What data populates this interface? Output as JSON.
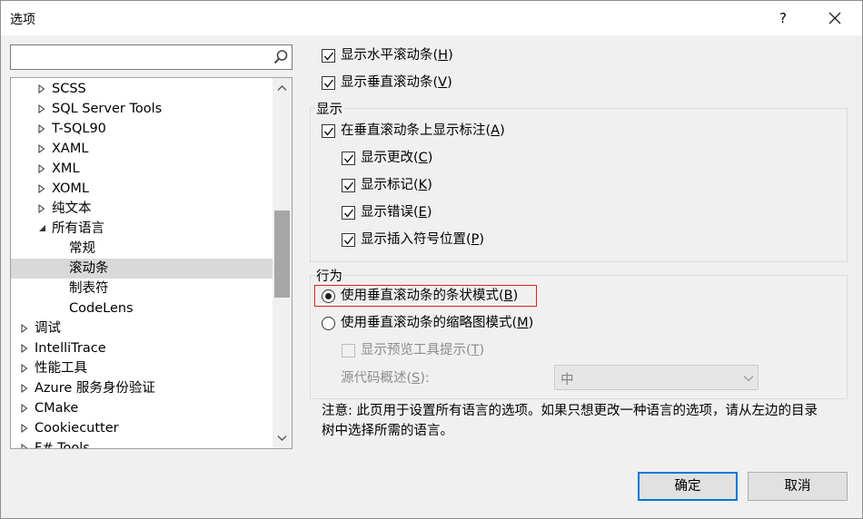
{
  "window": {
    "title": "选项",
    "help_label": "?"
  },
  "search": {
    "value": "",
    "placeholder": ""
  },
  "tree": {
    "items": [
      {
        "label": "SCSS",
        "level": 1,
        "arrow": "collapsed",
        "selected": false
      },
      {
        "label": "SQL Server Tools",
        "level": 1,
        "arrow": "collapsed",
        "selected": false
      },
      {
        "label": "T-SQL90",
        "level": 1,
        "arrow": "collapsed",
        "selected": false
      },
      {
        "label": "XAML",
        "level": 1,
        "arrow": "collapsed",
        "selected": false
      },
      {
        "label": "XML",
        "level": 1,
        "arrow": "collapsed",
        "selected": false
      },
      {
        "label": "XOML",
        "level": 1,
        "arrow": "collapsed",
        "selected": false
      },
      {
        "label": "纯文本",
        "level": 1,
        "arrow": "collapsed",
        "selected": false
      },
      {
        "label": "所有语言",
        "level": 1,
        "arrow": "expanded",
        "selected": false
      },
      {
        "label": "常规",
        "level": 2,
        "arrow": "none",
        "selected": false
      },
      {
        "label": "滚动条",
        "level": 2,
        "arrow": "none",
        "selected": true
      },
      {
        "label": "制表符",
        "level": 2,
        "arrow": "none",
        "selected": false
      },
      {
        "label": "CodeLens",
        "level": 2,
        "arrow": "none",
        "selected": false
      },
      {
        "label": "调试",
        "level": 0,
        "arrow": "collapsed",
        "selected": false
      },
      {
        "label": "IntelliTrace",
        "level": 0,
        "arrow": "collapsed",
        "selected": false
      },
      {
        "label": "性能工具",
        "level": 0,
        "arrow": "collapsed",
        "selected": false
      },
      {
        "label": "Azure 服务身份验证",
        "level": 0,
        "arrow": "collapsed",
        "selected": false
      },
      {
        "label": "CMake",
        "level": 0,
        "arrow": "collapsed",
        "selected": false
      },
      {
        "label": "Cookiecutter",
        "level": 0,
        "arrow": "collapsed",
        "selected": false
      },
      {
        "label": "F# Tools",
        "level": 0,
        "arrow": "collapsed",
        "selected": false
      }
    ]
  },
  "scrollbars": {
    "show_horizontal": {
      "label": "显示水平滚动条(",
      "key": "H",
      "end": ")",
      "checked": true
    },
    "show_vertical": {
      "label": "显示垂直滚动条(",
      "key": "V",
      "end": ")",
      "checked": true
    }
  },
  "display": {
    "title": "显示",
    "show_annotations": {
      "label": "在垂直滚动条上显示标注(",
      "key": "A",
      "end": ")",
      "checked": true
    },
    "show_changes": {
      "label": "显示更改(",
      "key": "C",
      "end": ")",
      "checked": true
    },
    "show_marks": {
      "label": "显示标记(",
      "key": "K",
      "end": ")",
      "checked": true
    },
    "show_errors": {
      "label": "显示错误(",
      "key": "E",
      "end": ")",
      "checked": true
    },
    "show_caret": {
      "label": "显示插入符号位置(",
      "key": "P",
      "end": ")",
      "checked": true
    }
  },
  "behavior": {
    "title": "行为",
    "bar_mode": {
      "label": "使用垂直滚动条的条状模式(",
      "key": "B",
      "end": ")",
      "selected": true
    },
    "map_mode": {
      "label": "使用垂直滚动条的缩略图模式(",
      "key": "M",
      "end": ")",
      "selected": false
    },
    "preview_tooltip": {
      "label": "显示预览工具提示(",
      "key": "T",
      "end": ")",
      "checked": false
    },
    "source_overview": {
      "label": "源代码概述(",
      "key": "S",
      "end": "):",
      "value": "中"
    }
  },
  "note": {
    "text": "注意: 此页用于设置所有语言的选项。如果只想更改一种语言的选项，请从左边的目录树中选择所需的语言。"
  },
  "buttons": {
    "ok": "确定",
    "cancel": "取消"
  },
  "colors": {
    "highlight_border": "#e0201f",
    "primary_border": "#0078d7",
    "selection": "#d9d9d9"
  }
}
